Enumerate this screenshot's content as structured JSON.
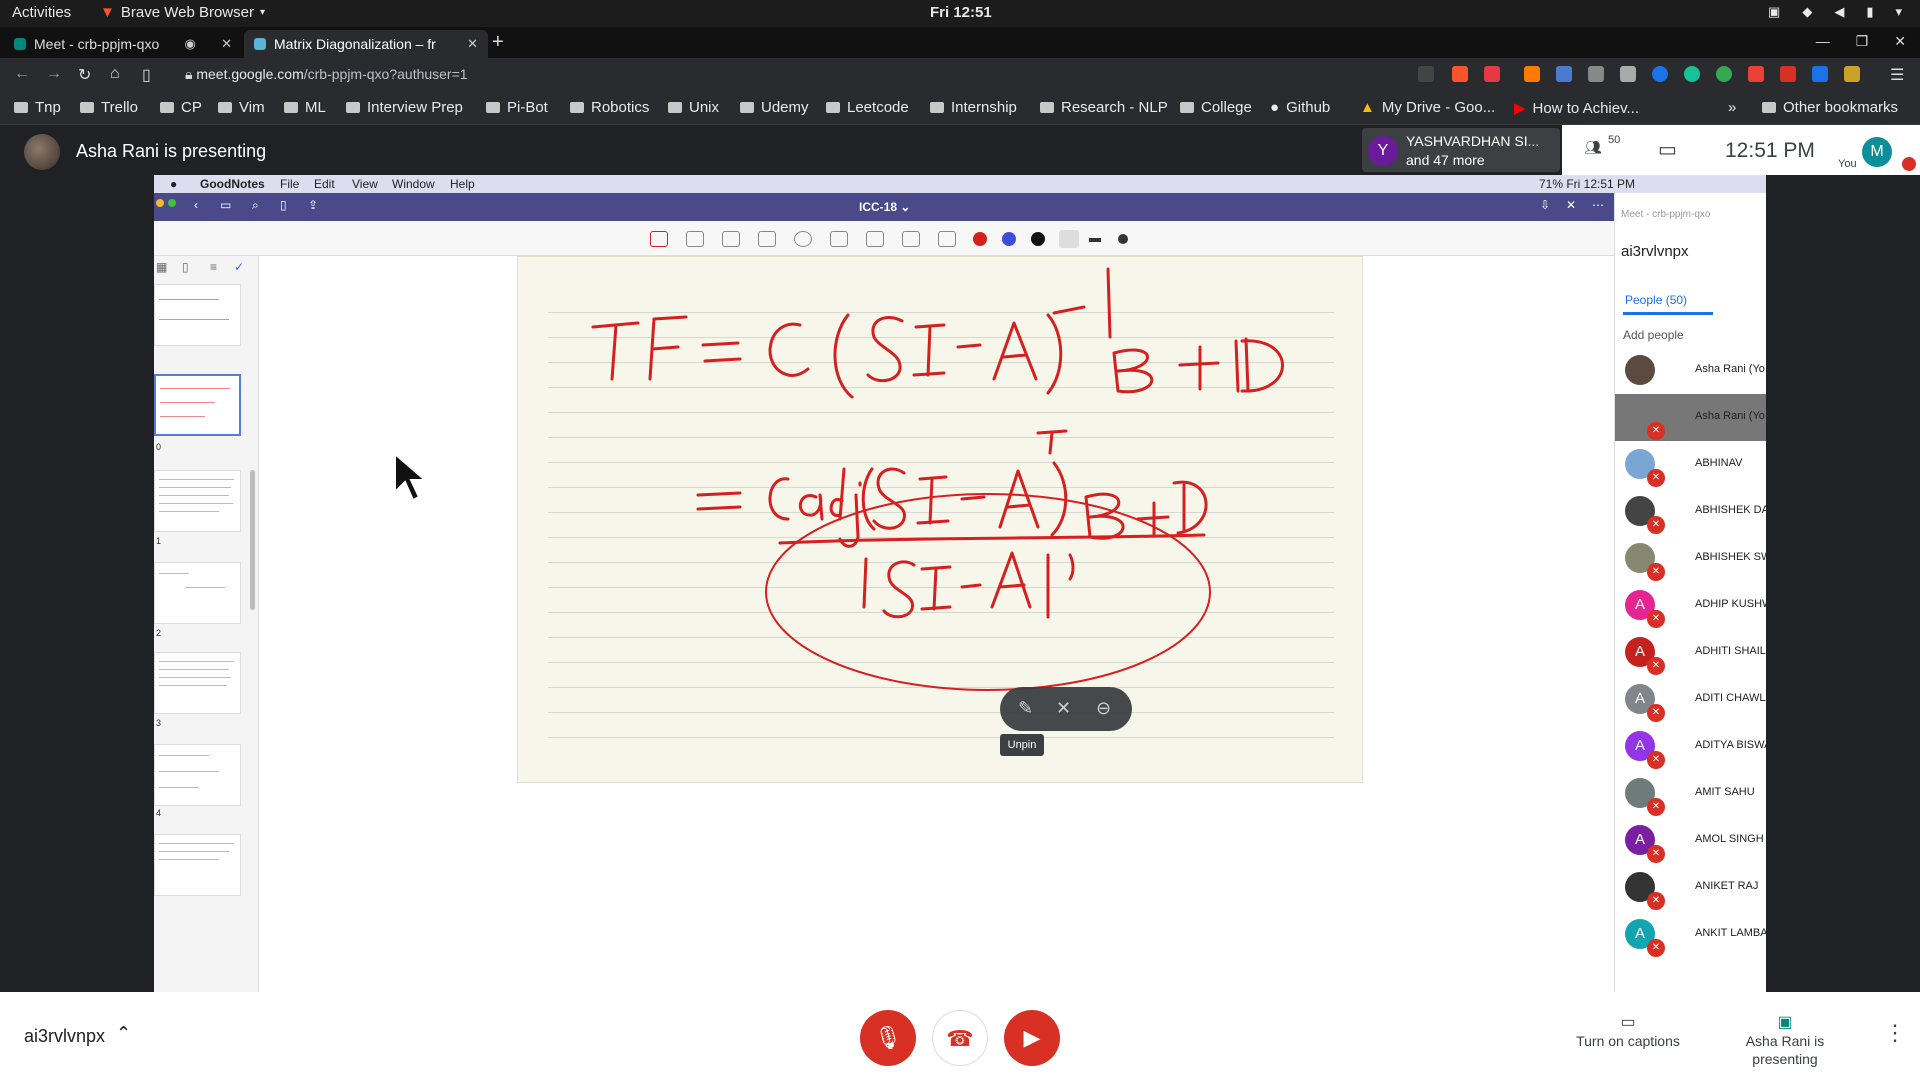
{
  "topbar": {
    "activities": "Activities",
    "browser": "Brave Web Browser",
    "clock": "Fri 12:51"
  },
  "tabs": [
    {
      "title": "Meet - crb-ppjm-qxo"
    },
    {
      "title": "Matrix Diagonalization – fr"
    }
  ],
  "address": {
    "host": "meet.google.com",
    "path": "/crb-ppjm-qxo?authuser=1"
  },
  "bookmarks": [
    "Tnp",
    "Trello",
    "CP",
    "Vim",
    "ML",
    "Interview Prep",
    "Pi-Bot",
    "Robotics",
    "Unix",
    "Udemy",
    "Leetcode",
    "Internship",
    "Research - NLP",
    "College",
    "Github",
    "My Drive - Goo...",
    "How to Achiev..."
  ],
  "other_bookmarks": "Other bookmarks",
  "meet": {
    "presenter_label": "Asha Rani is presenting",
    "participant_tile": {
      "initial": "Y",
      "name": "YASHVARDHAN SI...",
      "more": "and 47 more"
    },
    "people_count": "50",
    "time": "12:51 PM",
    "you_label": "You",
    "you_initial": "M"
  },
  "screen": {
    "mac_menu": [
      "GoodNotes",
      "File",
      "Edit",
      "View",
      "Window",
      "Help"
    ],
    "mac_status": "71%  Fri 12:51 PM",
    "doc_title": "ICC-18 ⌄",
    "side_meet_title": "Meet - crb-ppjm-qxo",
    "side_code": "ai3rvlvnpx",
    "people_tab": "People (50)",
    "add_people": "Add people",
    "participants": [
      {
        "name": "Asha Rani (Yo",
        "initial": "",
        "color": "#5a4a40"
      },
      {
        "name": "Asha Rani (Yo",
        "initial": "",
        "color": "#777777"
      },
      {
        "name": "ABHINAV",
        "initial": "",
        "color": "#7aa6d6"
      },
      {
        "name": "ABHISHEK DA",
        "initial": "",
        "color": "#444444"
      },
      {
        "name": "ABHISHEK SW",
        "initial": "",
        "color": "#888870"
      },
      {
        "name": "ADHIP KUSHW",
        "initial": "A",
        "color": "#e52592"
      },
      {
        "name": "ADHITI SHAILI",
        "initial": "A",
        "color": "#c5221f"
      },
      {
        "name": "ADITI CHAWLA",
        "initial": "A",
        "color": "#80868b"
      },
      {
        "name": "ADITYA BISWA",
        "initial": "A",
        "color": "#9334e6"
      },
      {
        "name": "AMIT SAHU",
        "initial": "",
        "color": "#6f7a7a"
      },
      {
        "name": "AMOL SINGH",
        "initial": "A",
        "color": "#7b1fa2"
      },
      {
        "name": "ANIKET RAJ",
        "initial": "",
        "color": "#333333"
      },
      {
        "name": "ANKIT LAMBA",
        "initial": "A",
        "color": "#12a4af"
      }
    ],
    "unpin_label": "Unpin",
    "thumb_numbers": [
      "",
      "0",
      "1",
      "2",
      "3",
      "4"
    ]
  },
  "bottom": {
    "meeting_code": "ai3rvlvnpx",
    "captions_label": "Turn on captions",
    "presenting_label": "Asha Rani is presenting"
  },
  "colors": {
    "accent": "#1a73e8",
    "danger": "#d93025",
    "ink": "#d62020"
  }
}
